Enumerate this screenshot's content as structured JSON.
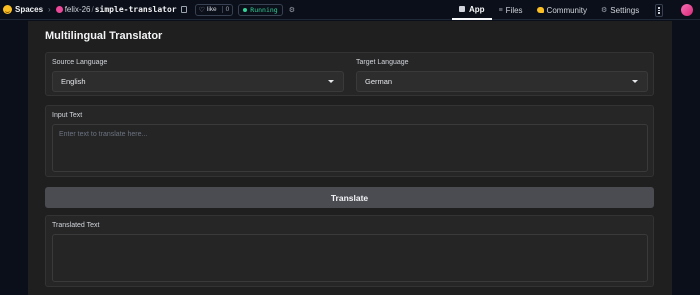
{
  "topbar": {
    "brand_label": "Spaces",
    "owner": "felix-26",
    "repo": "simple-translator",
    "like_label": "like",
    "like_count": "0",
    "status": "Running",
    "icons": {
      "brand": "hugging-face-emoji-icon",
      "copy": "copy-icon",
      "like": "heart-icon",
      "status": "status-dot-icon",
      "gpu": "hardware-icon"
    },
    "colors": {
      "status": "#34d399",
      "avatar": "#ec4899",
      "brand": "#fbbf24"
    }
  },
  "nav": {
    "items": [
      {
        "label": "App",
        "icon": "app-icon",
        "active": true
      },
      {
        "label": "Files",
        "icon": "files-icon",
        "active": false
      },
      {
        "label": "Community",
        "icon": "community-icon",
        "active": false
      },
      {
        "label": "Settings",
        "icon": "gear-icon",
        "active": false
      }
    ]
  },
  "app": {
    "title": "Multilingual Translator",
    "source_label": "Source Language",
    "source_value": "English",
    "target_label": "Target Language",
    "target_value": "German",
    "input_label": "Input Text",
    "input_placeholder": "Enter text to translate here...",
    "translate_label": "Translate",
    "output_label": "Translated Text",
    "output_value": ""
  }
}
